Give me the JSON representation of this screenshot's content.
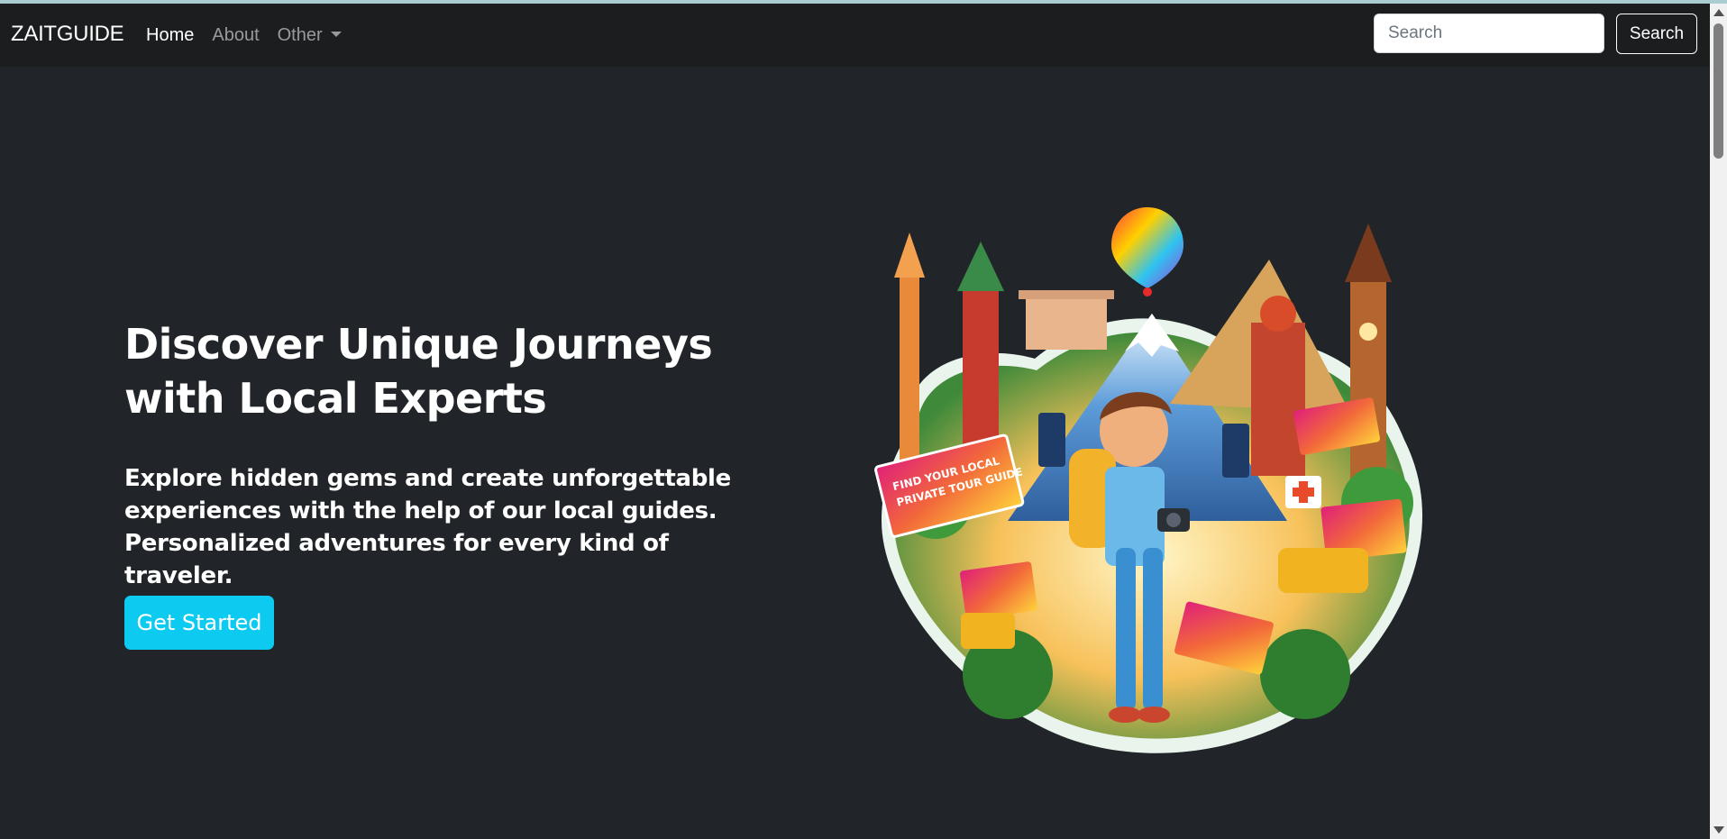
{
  "navbar": {
    "brand": "ZAITGUIDE",
    "links": [
      {
        "label": "Home",
        "active": true
      },
      {
        "label": "About",
        "active": false
      },
      {
        "label": "Other",
        "active": false,
        "dropdown": true
      }
    ],
    "search": {
      "placeholder": "Search",
      "value": "",
      "button_label": "Search"
    }
  },
  "hero": {
    "title": "Discover Unique Journeys with Local Experts",
    "lead": "Explore hidden gems and create unforgettable experiences with the help of our local guides. Personalized adventures for every kind of traveler.",
    "cta_label": "Get Started",
    "illustration": {
      "sign_text_1": "FIND YOUR LOCAL",
      "sign_text_2": "PRIVATE TOUR GUIDE"
    }
  },
  "colors": {
    "background": "#212529",
    "navbar": "#1c1d1f",
    "accent": "#0dcaf0",
    "text": "#ffffff",
    "muted_link": "rgba(255,255,255,0.55)"
  },
  "icons": [
    "dropdown-caret-icon",
    "location-pin-icon",
    "scroll-up-arrow-icon",
    "scroll-down-arrow-icon"
  ]
}
